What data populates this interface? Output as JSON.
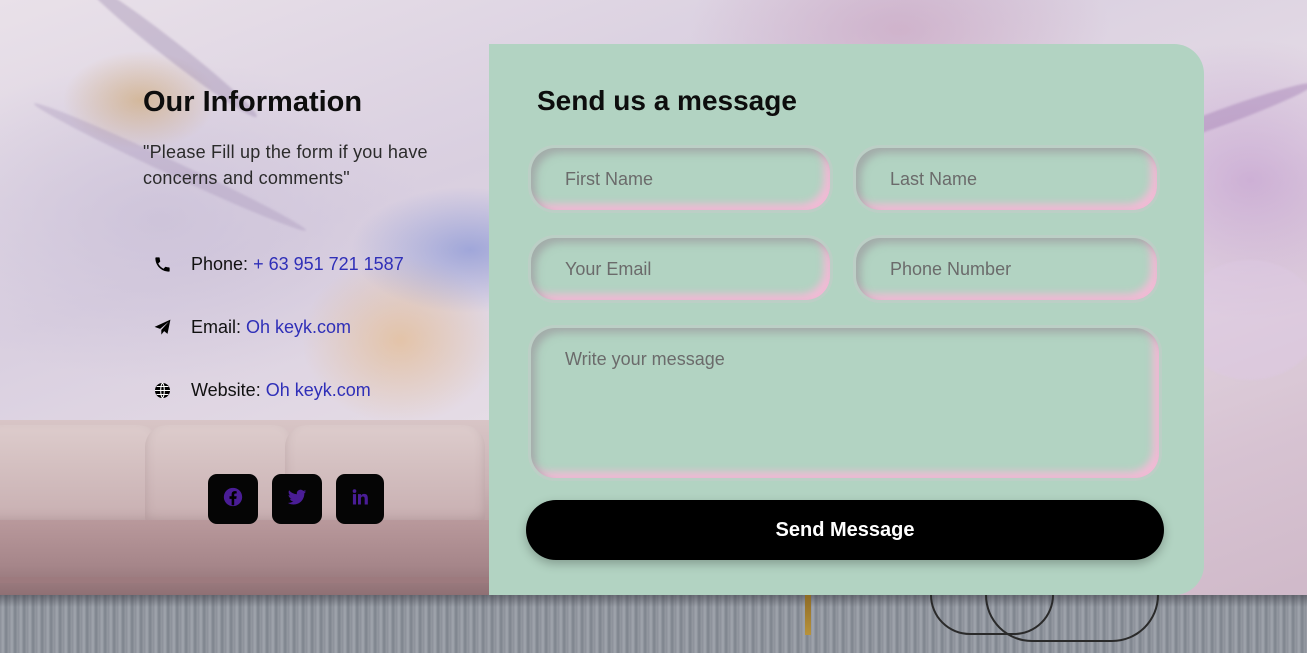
{
  "info": {
    "title": "Our Information",
    "quote": "\"Please Fill up the form if you have concerns and comments\"",
    "contacts": [
      {
        "label": "Phone:",
        "value": "+ 63 951 721 1587",
        "icon": "phone-icon"
      },
      {
        "label": "Email:",
        "value": "Oh keyk.com",
        "icon": "paper-plane-icon"
      },
      {
        "label": "Website:",
        "value": "Oh keyk.com",
        "icon": "globe-icon"
      }
    ],
    "socials": [
      {
        "icon": "facebook-icon"
      },
      {
        "icon": "twitter-icon"
      },
      {
        "icon": "linkedin-icon"
      }
    ]
  },
  "form": {
    "title": "Send us a message",
    "first_name_placeholder": "First Name",
    "last_name_placeholder": "Last Name",
    "email_placeholder": "Your Email",
    "phone_placeholder": "Phone Number",
    "message_placeholder": "Write your message",
    "submit_label": "Send Message"
  },
  "colors": {
    "card_background": "#b2d3c2",
    "link": "#2f2fb8",
    "social_icon": "#4a1d96",
    "button": "#000000"
  }
}
